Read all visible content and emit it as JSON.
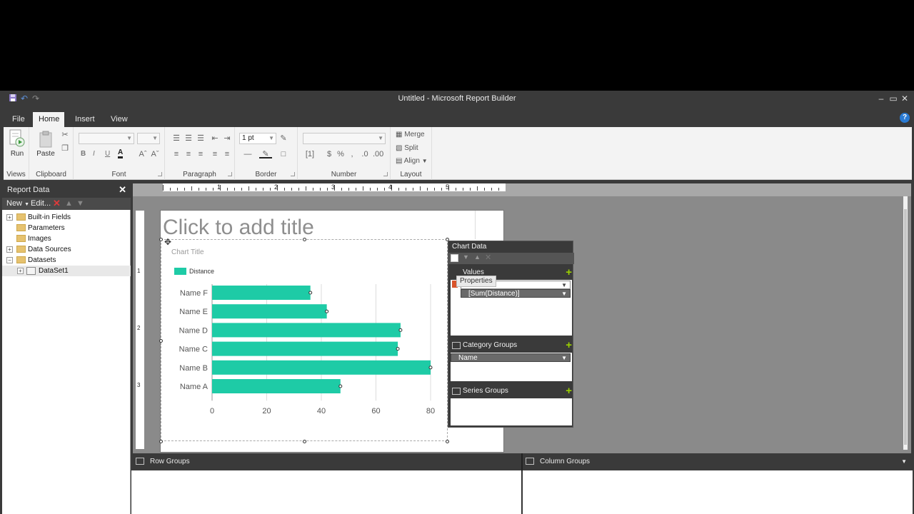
{
  "window": {
    "title": "Untitled - Microsoft Report Builder",
    "help": "?"
  },
  "tabs": [
    {
      "label": "File",
      "active": false
    },
    {
      "label": "Home",
      "active": true
    },
    {
      "label": "Insert",
      "active": false
    },
    {
      "label": "View",
      "active": false
    }
  ],
  "ribbon": {
    "run_label": "Run",
    "paste_label": "Paste",
    "border_weight": "1 pt",
    "merge_label": "Merge",
    "split_label": "Split",
    "align_label": "Align",
    "bold": "B",
    "italic": "I",
    "underline": "U",
    "font_color": "A",
    "groups": {
      "views": "Views",
      "clipboard": "Clipboard",
      "font": "Font",
      "paragraph": "Paragraph",
      "border": "Border",
      "number": "Number",
      "layout": "Layout"
    }
  },
  "report_data": {
    "header": "Report Data",
    "new_label": "New",
    "edit_label": "Edit...",
    "items": [
      {
        "label": "Built-in Fields",
        "expander": "+"
      },
      {
        "label": "Parameters",
        "expander": ""
      },
      {
        "label": "Images",
        "expander": ""
      },
      {
        "label": "Data Sources",
        "expander": "+"
      },
      {
        "label": "Datasets",
        "expander": "−"
      },
      {
        "label": "DataSet1",
        "expander": "+"
      }
    ]
  },
  "report": {
    "title_placeholder": "Click to add title"
  },
  "rulers": {
    "top_numbers": [
      "1",
      "2",
      "3",
      "4",
      "5"
    ],
    "left_numbers": [
      "1",
      "2",
      "3"
    ]
  },
  "chart_data": {
    "type": "bar",
    "title": "Chart Title",
    "categories": [
      "Name F",
      "Name E",
      "Name D",
      "Name C",
      "Name B",
      "Name A"
    ],
    "series": [
      {
        "name": "Distance",
        "values": [
          36,
          42,
          69,
          68,
          80,
          47
        ],
        "color": "#1ecba6"
      }
    ],
    "xlim": [
      0,
      80
    ],
    "x_ticks": [
      "0",
      "20",
      "40",
      "60",
      "80"
    ],
    "grid": true,
    "legend_position": "top-left"
  },
  "chart_data_pane": {
    "header": "Chart Data",
    "values_label": "Values",
    "values_field": "[Sum(Distance)]",
    "category_groups_label": "Category Groups",
    "category_field": "Name",
    "series_groups_label": "Series Groups",
    "tooltip": "Properties"
  },
  "groups": {
    "row_groups": "Row Groups",
    "column_groups": "Column Groups"
  }
}
